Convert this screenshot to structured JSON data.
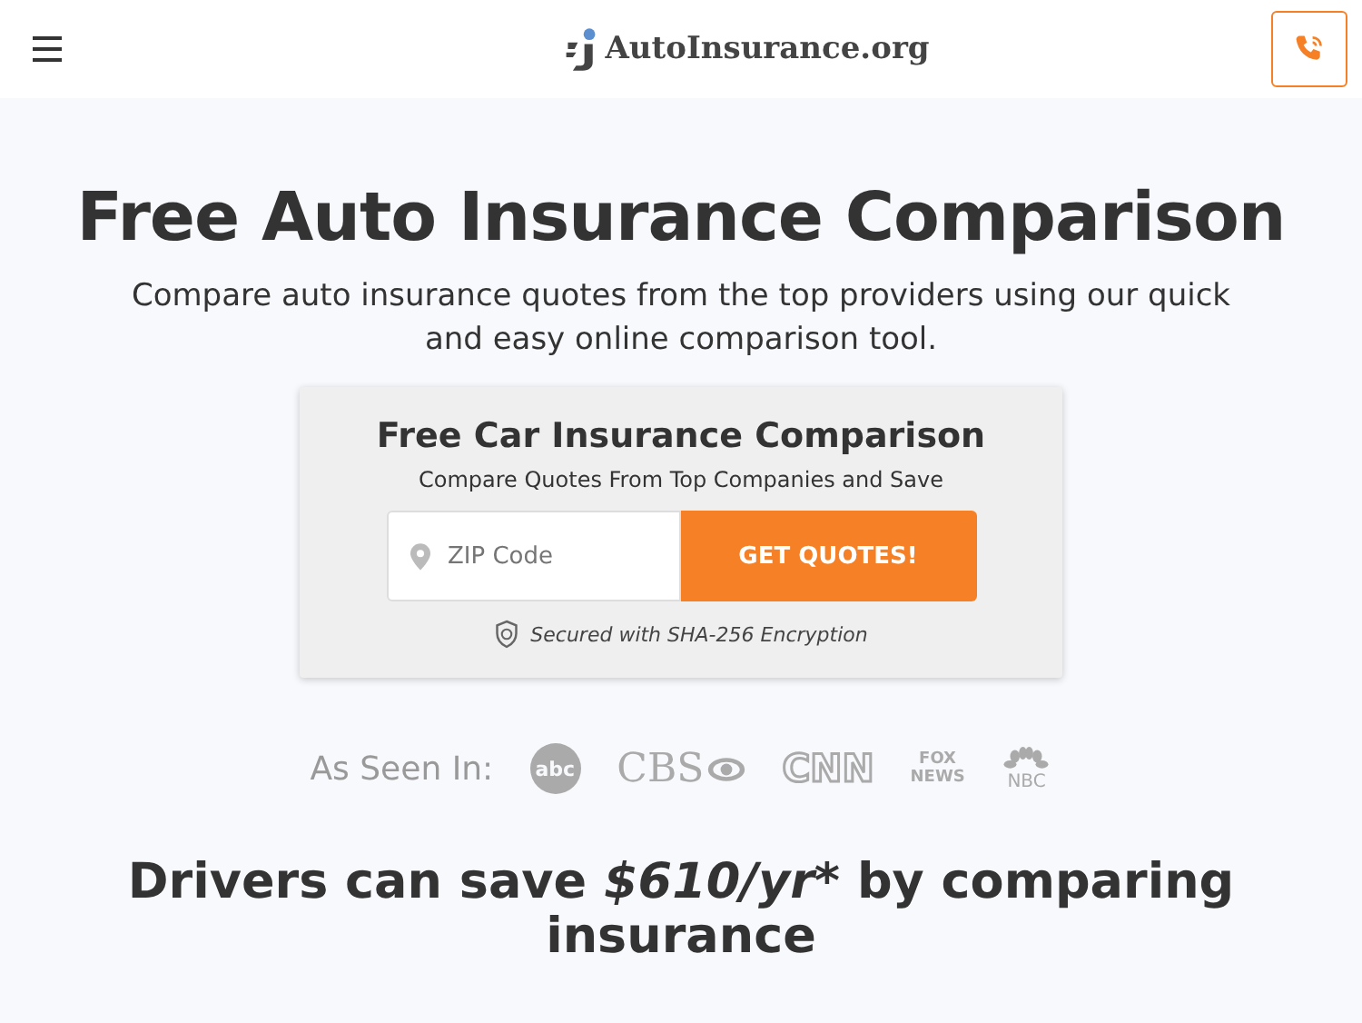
{
  "header": {
    "logo": "AutoInsurance.org"
  },
  "hero": {
    "title": "Free Auto Insurance Comparison",
    "subtitle": "Compare auto insurance quotes from the top providers using our quick and easy online comparison tool."
  },
  "form": {
    "title": "Free Car Insurance Comparison",
    "subtitle": "Compare Quotes From Top Companies and Save",
    "zip": {
      "placeholder": "ZIP Code"
    },
    "button": "GET QUOTES!",
    "security": "Secured with SHA-256 Encryption"
  },
  "as_seen_in": {
    "label": "As Seen In:",
    "logos": [
      {
        "kind": "abc",
        "text": "abc"
      },
      {
        "kind": "cbs",
        "text": "CBS"
      },
      {
        "kind": "cnn",
        "text": "CNN"
      },
      {
        "kind": "fox",
        "text": "FOX NEWS"
      },
      {
        "kind": "nbc",
        "text": "NBC"
      }
    ]
  },
  "savings": {
    "before": "Drivers can save ",
    "highlight": "$610/yr*",
    "after": " by comparing insurance"
  }
}
